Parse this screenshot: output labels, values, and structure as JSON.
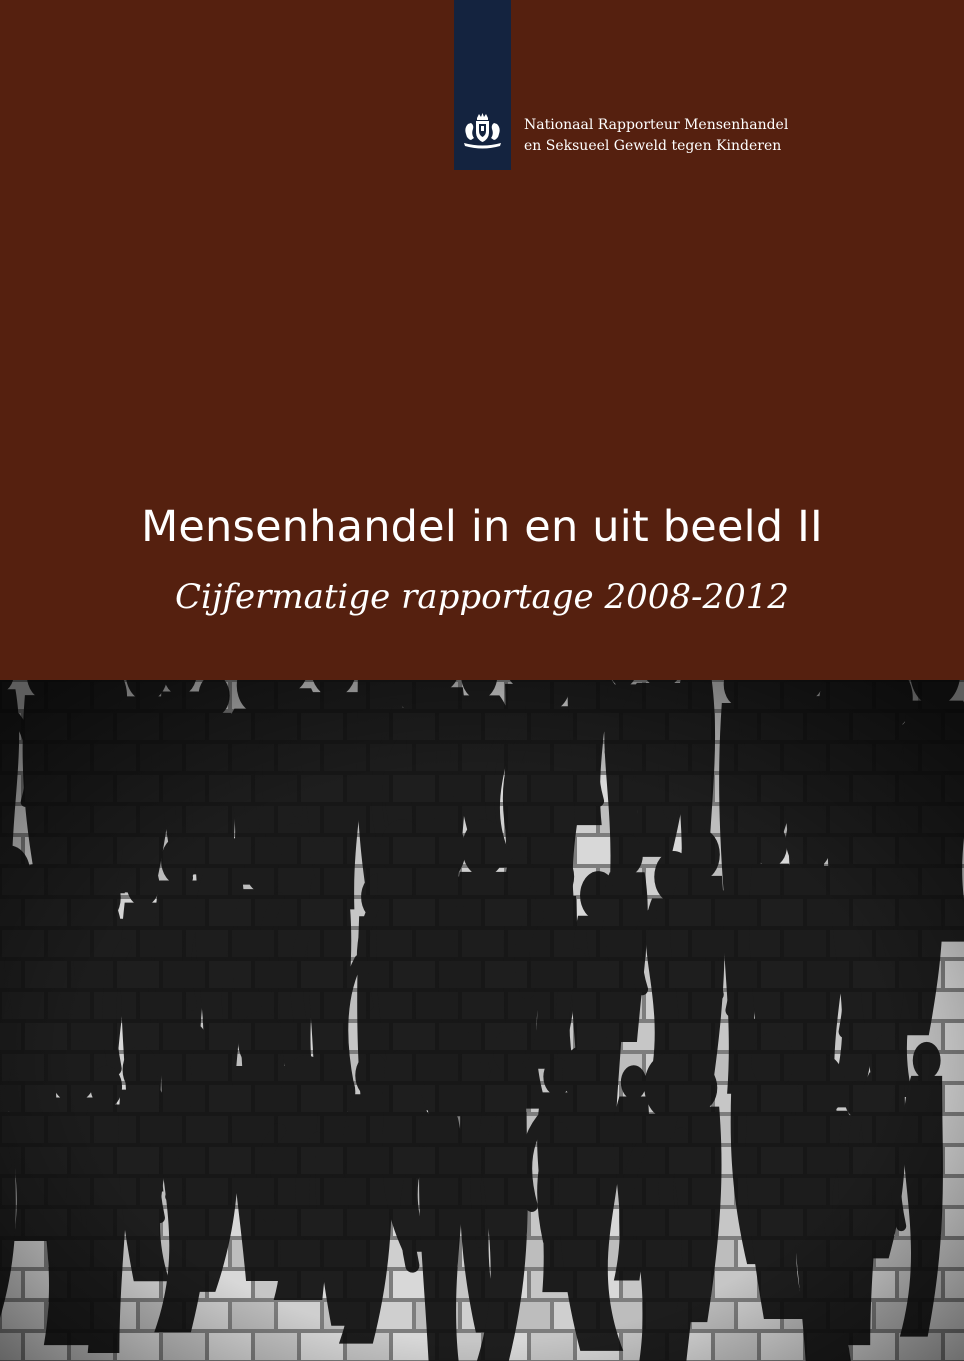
{
  "header": {
    "org_line1": "Nationaal Rapporteur Mensenhandel",
    "org_line2": "en Seksueel Geweld tegen Kinderen",
    "logo_icon": "coat-of-arms-icon"
  },
  "cover": {
    "title": "Mensenhandel in en uit beeld II",
    "subtitle": "Cijfermatige rapportage 2008-2012"
  },
  "colors": {
    "panel": "#55200f",
    "ribbon": "#14233f",
    "text": "#ffffff"
  },
  "image": {
    "subject": "brick-wall-with-human-shadows-photo"
  }
}
